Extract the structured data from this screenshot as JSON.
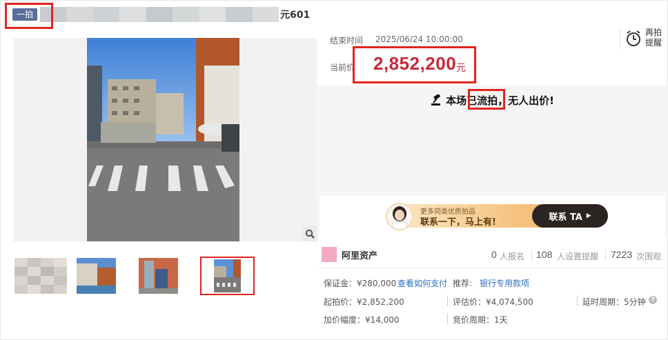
{
  "header": {
    "tag": "一拍",
    "title_suffix": "元601"
  },
  "auction": {
    "end_label": "结束时间",
    "end_time": "2025/06/24 10:00:00",
    "price_label": "当前价",
    "price": "2,852,200",
    "price_unit": "元",
    "remind_label_1": "再拍",
    "remind_label_2": "提醒",
    "status": "本场已流拍，无人出价!"
  },
  "banner": {
    "subtitle": "更多同类优质拍品",
    "main": "联系一下，马上有!",
    "button": "联系 TA"
  },
  "seller": {
    "name": "阿里资产",
    "stats": [
      {
        "num": "0",
        "label": "人报名"
      },
      {
        "num": "108",
        "label": "人设置提醒"
      },
      {
        "num": "7223",
        "label": "次围观"
      }
    ]
  },
  "details": {
    "deposit": "保证金：¥280,000",
    "pay_link": "查看如何支付",
    "recommend_label": "推荐:",
    "recommend_link": "银行专用款项",
    "start_price": "起拍价：¥2,852,200",
    "assess_price": "评估价：¥4,074,500",
    "delay": "延时周期：5分钟",
    "increment": "加价幅度：¥14,000",
    "bid_period": "竞价周期：1天"
  },
  "colors": {
    "accent_red": "#c8283a",
    "link_blue": "#2a6ec4",
    "highlight_box": "#e0241c"
  }
}
